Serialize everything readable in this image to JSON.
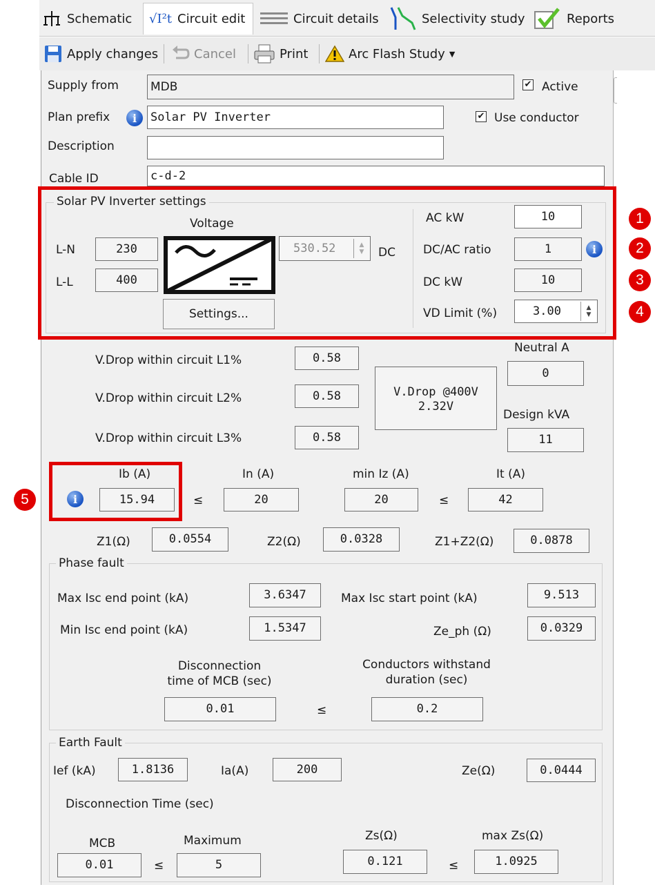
{
  "tabs": [
    {
      "label": "Schematic",
      "icon": "schematic-icon"
    },
    {
      "label": "Circuit edit",
      "icon": "i2t-icon"
    },
    {
      "label": "Circuit details",
      "icon": "list-icon"
    },
    {
      "label": "Selectivity study",
      "icon": "selectivity-icon"
    },
    {
      "label": "Reports",
      "icon": "reports-check-icon"
    }
  ],
  "toolbar": {
    "apply": "Apply changes",
    "cancel": "Cancel",
    "print": "Print",
    "arc": "Arc Flash Study"
  },
  "form": {
    "supply_label": "Supply from",
    "supply_value": "MDB",
    "active_label": "Active",
    "active_checked": true,
    "plan_label": "Plan prefix",
    "plan_value": "Solar PV Inverter",
    "use_conductor_label": "Use conductor",
    "use_conductor_checked": true,
    "desc_label": "Description",
    "desc_value": "",
    "cable_label": "Cable ID",
    "cable_value": "c-d-2"
  },
  "solar": {
    "title": "Solar PV Inverter settings",
    "voltage_label": "Voltage",
    "ln_label": "L-N",
    "ln_value": "230",
    "ll_label": "L-L",
    "ll_value": "400",
    "dc_value": "530.52",
    "dc_label": "DC",
    "settings_button": "Settings...",
    "ac_kw_label": "AC kW",
    "ac_kw_value": "10",
    "ratio_label": "DC/AC ratio",
    "ratio_value": "1",
    "dc_kw_label": "DC kW",
    "dc_kw_value": "10",
    "vd_label": "VD Limit (%)",
    "vd_value": "3.00"
  },
  "callouts": [
    "1",
    "2",
    "3",
    "4",
    "5"
  ],
  "vdrop": {
    "l1_label": "V.Drop within circuit L1%",
    "l1_value": "0.58",
    "l2_label": "V.Drop within circuit L2%",
    "l2_value": "0.58",
    "l3_label": "V.Drop within circuit L3%",
    "l3_value": "0.58",
    "summary_line1": "V.Drop @400V",
    "summary_line2": "2.32V",
    "neutral_label": "Neutral A",
    "neutral_value": "0",
    "design_label": "Design kVA",
    "design_value": "11"
  },
  "currents": {
    "ib_label": "Ib (A)",
    "ib_value": "15.94",
    "in_label": "In (A)",
    "in_value": "20",
    "miniz_label": "min Iz (A)",
    "miniz_value": "20",
    "it_label": "It (A)",
    "it_value": "42",
    "le": "≤"
  },
  "impedance": {
    "z1_label": "Z1(Ω)",
    "z1_value": "0.0554",
    "z2_label": "Z2(Ω)",
    "z2_value": "0.0328",
    "z12_label": "Z1+Z2(Ω)",
    "z12_value": "0.0878"
  },
  "phase_fault": {
    "title": "Phase fault",
    "max_end_label": "Max Isc end point (kA)",
    "max_end_value": "3.6347",
    "max_start_label": "Max Isc start point (kA)",
    "max_start_value": "9.513",
    "min_end_label": "Min Isc end point (kA)",
    "min_end_value": "1.5347",
    "zeph_label": "Ze_ph (Ω)",
    "zeph_value": "0.0329",
    "disc_label_1": "Disconnection",
    "disc_label_2": "time of MCB (sec)",
    "disc_value": "0.01",
    "withstand_label_1": "Conductors withstand",
    "withstand_label_2": "duration (sec)",
    "withstand_value": "0.2"
  },
  "earth_fault": {
    "title": "Earth Fault",
    "ief_label": "Ief (kA)",
    "ief_value": "1.8136",
    "ia_label": "Ia(A)",
    "ia_value": "200",
    "ze_label": "Ze(Ω)",
    "ze_value": "0.0444",
    "disc_time_label": "Disconnection Time (sec)",
    "mcb_label": "MCB",
    "mcb_value": "0.01",
    "max_label": "Maximum",
    "max_value": "5",
    "zs_label": "Zs(Ω)",
    "zs_value": "0.121",
    "maxzs_label": "max Zs(Ω)",
    "maxzs_value": "1.0925"
  },
  "colors": {
    "highlight": "#e00000",
    "info": "#1a55c4"
  }
}
